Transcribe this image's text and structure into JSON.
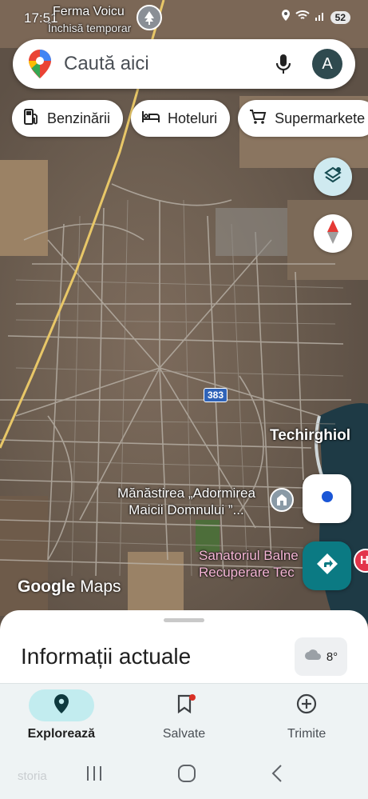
{
  "status_bar": {
    "time": "17:51",
    "battery": "52"
  },
  "map": {
    "poi_top": {
      "name": "Ferma Voicu",
      "status": "Închisă temporar"
    },
    "town": "Techirghiol",
    "monastery": {
      "line1": "Mănăstirea „Adormirea",
      "line2": "Maicii Domnului ”..."
    },
    "sanatorium": {
      "line1": "Sanatoriul Balne",
      "line2": "Recuperare Tec"
    },
    "road_number": "383",
    "attribution": {
      "google": "Google",
      "maps": "Maps"
    },
    "hospital_letter": "H"
  },
  "search": {
    "placeholder": "Caută aici",
    "avatar_letter": "A"
  },
  "chips": [
    {
      "label": "Benzinării",
      "icon": "gas-station-icon"
    },
    {
      "label": "Hoteluri",
      "icon": "bed-icon"
    },
    {
      "label": "Supermarkete",
      "icon": "cart-icon"
    }
  ],
  "sheet": {
    "title": "Informații actuale",
    "temperature": "8°"
  },
  "bottom_nav": [
    {
      "label": "Explorează",
      "icon": "location-pin-icon",
      "active": true
    },
    {
      "label": "Salvate",
      "icon": "bookmark-icon",
      "active": false
    },
    {
      "label": "Trimite",
      "icon": "add-circle-icon",
      "active": false
    }
  ],
  "watermark": "storia",
  "colors": {
    "teal": "#0b7a83",
    "active_pill": "#c2ecef",
    "nav_bg": "#eef3f4",
    "road_yellow": "#e8c768"
  }
}
